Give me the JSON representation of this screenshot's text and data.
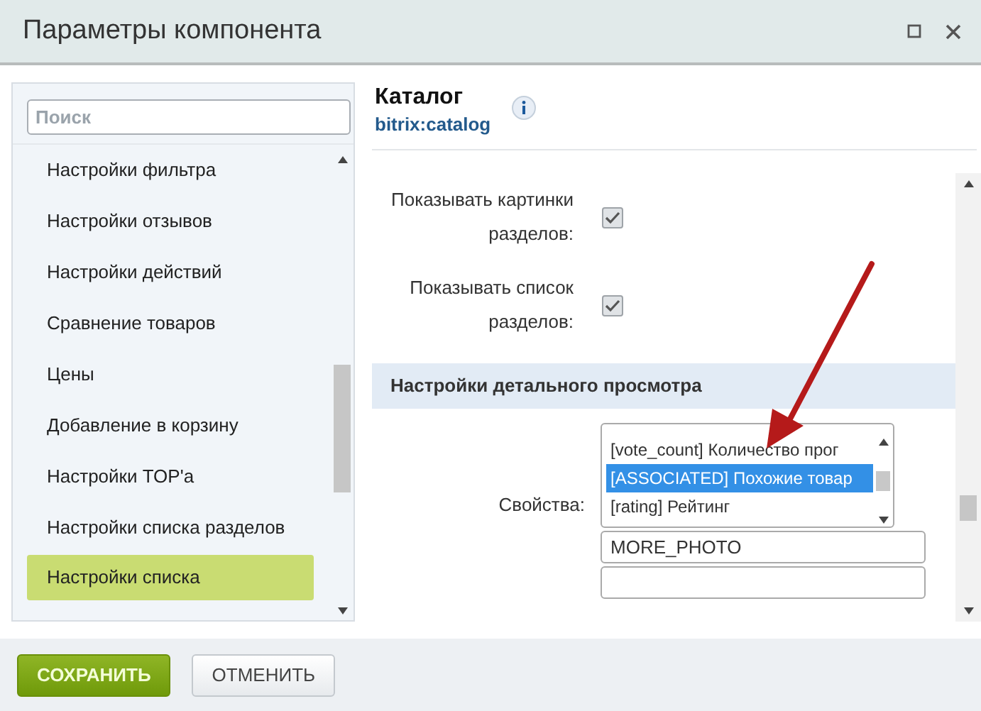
{
  "window": {
    "title": "Параметры компонента"
  },
  "sidebar": {
    "search": {
      "placeholder": "Поиск"
    },
    "items": [
      {
        "label": "Настройки фильтра",
        "selected": false
      },
      {
        "label": "Настройки отзывов",
        "selected": false
      },
      {
        "label": "Настройки действий",
        "selected": false
      },
      {
        "label": "Сравнение товаров",
        "selected": false
      },
      {
        "label": "Цены",
        "selected": false
      },
      {
        "label": "Добавление в корзину",
        "selected": false
      },
      {
        "label": "Настройки TOP'а",
        "selected": false
      },
      {
        "label": "Настройки списка разделов",
        "selected": false
      },
      {
        "label": "Настройки списка",
        "selected": true
      }
    ]
  },
  "component": {
    "title": "Каталог",
    "code": "bitrix:catalog"
  },
  "settings": [
    {
      "label": "Показывать картинки разделов:",
      "checked": true
    },
    {
      "label": "Показывать список разделов:",
      "checked": true
    }
  ],
  "section": {
    "title": "Настройки детального просмотра",
    "field_label": "Свойства:",
    "options": [
      {
        "label": "[vote_count] Количество прог",
        "selected": false
      },
      {
        "label": "[ASSOCIATED] Похожие товар",
        "selected": true
      },
      {
        "label": "[rating] Рейтинг",
        "selected": false
      }
    ],
    "inputs": [
      {
        "value": "MORE_PHOTO"
      }
    ]
  },
  "buttons": [
    {
      "label": "СОХРАНИТЬ",
      "kind": "primary"
    },
    {
      "label": "ОТМЕНИТЬ",
      "kind": "secondary"
    }
  ]
}
